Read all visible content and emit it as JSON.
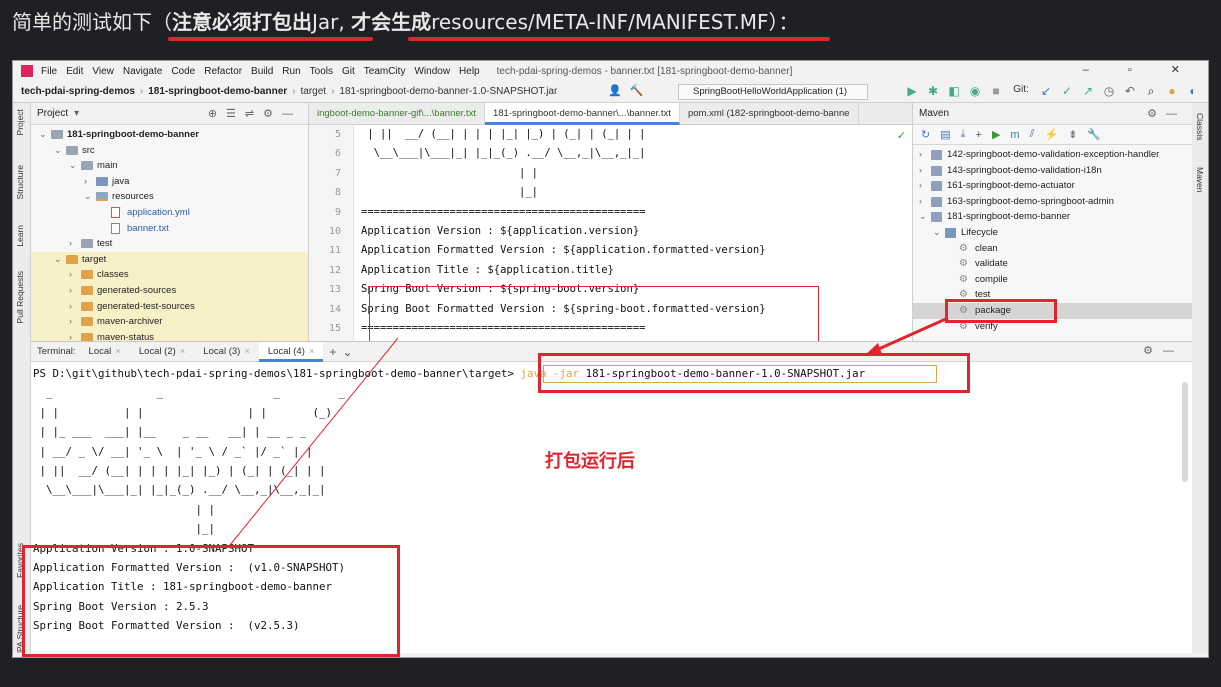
{
  "caption": {
    "prefix": "简单的测试如下（",
    "highlight1": "注意必须打包出",
    "mid": "Jar, ",
    "highlight2": "才会生成",
    "suffix": "resources/META-INF/MANIFEST.MF）："
  },
  "menu": [
    "File",
    "Edit",
    "View",
    "Navigate",
    "Code",
    "Refactor",
    "Build",
    "Run",
    "Tools",
    "Git",
    "TeamCity",
    "Window",
    "Help"
  ],
  "window_title": "tech-pdai-spring-demos - banner.txt [181-springboot-demo-banner]",
  "window_controls": "–  ▫  ✕",
  "breadcrumb": {
    "project": "tech-pdai-spring-demos",
    "module": "181-springboot-demo-banner",
    "folder": "target",
    "file": "181-springboot-demo-banner-1.0-SNAPSHOT.jar"
  },
  "run_config": "SpringBootHelloWorldApplication (1)",
  "git_label": "Git:",
  "project_panel": {
    "title": "Project",
    "items": [
      {
        "label": "181-springboot-demo-banner",
        "depth": 0,
        "kind": "module",
        "open": true
      },
      {
        "label": "src",
        "depth": 1,
        "kind": "folder",
        "open": true
      },
      {
        "label": "main",
        "depth": 2,
        "kind": "folder",
        "open": true
      },
      {
        "label": "java",
        "depth": 3,
        "kind": "blue",
        "open": false
      },
      {
        "label": "resources",
        "depth": 3,
        "kind": "res",
        "open": true
      },
      {
        "label": "application.yml",
        "depth": 4,
        "kind": "yml"
      },
      {
        "label": "banner.txt",
        "depth": 4,
        "kind": "txt"
      },
      {
        "label": "test",
        "depth": 2,
        "kind": "folder",
        "open": false
      },
      {
        "label": "target",
        "depth": 1,
        "kind": "orange",
        "open": true
      },
      {
        "label": "classes",
        "depth": 2,
        "kind": "orange",
        "open": false
      },
      {
        "label": "generated-sources",
        "depth": 2,
        "kind": "orange",
        "open": false
      },
      {
        "label": "generated-test-sources",
        "depth": 2,
        "kind": "orange",
        "open": false
      },
      {
        "label": "maven-archiver",
        "depth": 2,
        "kind": "orange",
        "open": false
      },
      {
        "label": "maven-status",
        "depth": 2,
        "kind": "orange",
        "open": false
      }
    ]
  },
  "left_stripe": [
    "Project",
    "Structure",
    "Learn",
    "Pull Requests",
    "Favorites",
    "JPA Structure"
  ],
  "right_stripe": [
    "Classis",
    "Maven"
  ],
  "editor": {
    "tabs": [
      "ingboot-demo-banner-gif\\...\\banner.txt",
      "181-springboot-demo-banner\\...\\banner.txt",
      "pom.xml (182-springboot-demo-banne"
    ],
    "line_numbers": [
      "5",
      "6",
      "7",
      "8",
      "9",
      "10",
      "11",
      "12",
      "13",
      "14",
      "15"
    ],
    "lines": [
      " | ||  __/ (__| | | | |_| |_) | (_| | (_| | |",
      "  \\__\\___|\\___|_| |_|_(_) .__/ \\__,_|\\__,_|_|",
      "                         | |",
      "                         |_|",
      "=============================================",
      "Application Version : ${application.version}",
      "Application Formatted Version : ${application.formatted-version}",
      "Application Title : ${application.title}",
      "Spring Boot Version : ${spring-boot.version}",
      "Spring Boot Formatted Version : ${spring-boot.formatted-version}",
      "============================================="
    ]
  },
  "maven": {
    "title": "Maven",
    "items": [
      {
        "label": "142-springboot-demo-validation-exception-handler",
        "kind": "module"
      },
      {
        "label": "143-springboot-demo-validation-i18n",
        "kind": "module"
      },
      {
        "label": "161-springboot-demo-actuator",
        "kind": "module"
      },
      {
        "label": "163-springboot-demo-springboot-admin",
        "kind": "module"
      },
      {
        "label": "181-springboot-demo-banner",
        "kind": "module-open"
      },
      {
        "label": "Lifecycle",
        "kind": "lifecycle"
      },
      {
        "label": "clean",
        "kind": "goal"
      },
      {
        "label": "validate",
        "kind": "goal"
      },
      {
        "label": "compile",
        "kind": "goal"
      },
      {
        "label": "test",
        "kind": "goal"
      },
      {
        "label": "package",
        "kind": "goal-selected"
      },
      {
        "label": "verify",
        "kind": "goal"
      }
    ]
  },
  "terminal": {
    "label": "Terminal:",
    "tabs": [
      "Local",
      "Local (2)",
      "Local (3)",
      "Local (4)"
    ],
    "active_tab": 3,
    "prompt": "PS D:\\git\\github\\tech-pdai-spring-demos\\181-springboot-demo-banner\\target> ",
    "cmd_java": "java",
    "cmd_jar": " -jar",
    "cmd_rest": " 181-springboot-demo-banner-1.0-SNAPSHOT.jar",
    "banner": [
      "  _                _                 _         _",
      " | |          | |                | |       (_)",
      " | |_ ___  ___| |__    _ __   __| | __ _ _",
      " | __/ _ \\/ __| '_ \\  | '_ \\ / _` |/ _` | |",
      " | ||  __/ (__| | | | |_| |_) | (_| | (_| | |",
      "  \\__\\___|\\___|_| |_|_(_) .__/ \\__,_|\\__,_|_|",
      "                         | |",
      "                         |_|"
    ],
    "output": [
      "Application Version : 1.0-SNAPSHOT",
      "Application Formatted Version :  (v1.0-SNAPSHOT)",
      "Application Title : 181-springboot-demo-banner",
      "Spring Boot Version : 2.5.3",
      "Spring Boot Formatted Version :  (v2.5.3)"
    ]
  },
  "annotation": "打包运行后",
  "colors": {
    "accent_red": "#e0252e",
    "accent_blue": "#4a82d4",
    "cmd_orange": "#e0a24a"
  }
}
